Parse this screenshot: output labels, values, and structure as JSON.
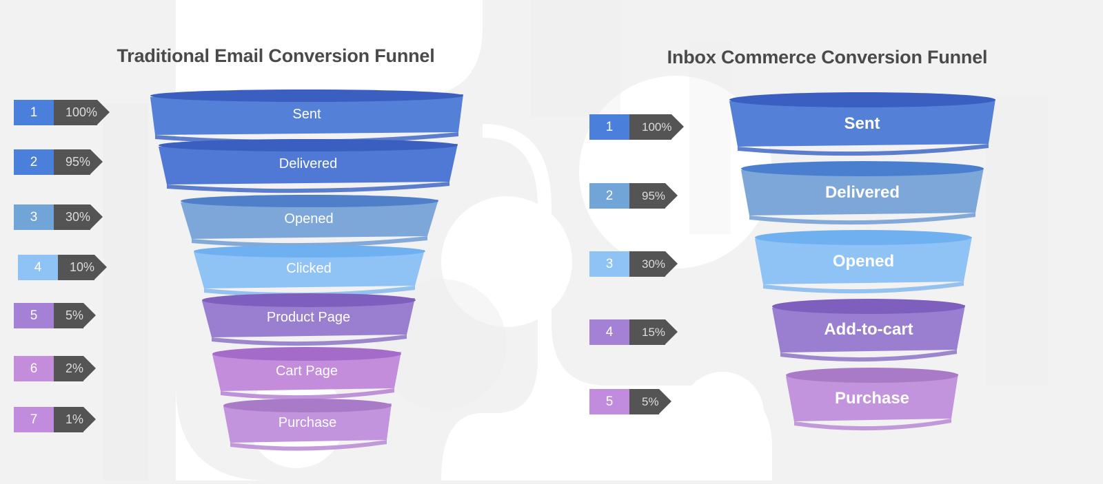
{
  "chart_data": [
    {
      "type": "funnel",
      "title": "Traditional Email Conversion Funnel",
      "side": "left",
      "categories": [
        "Sent",
        "Delivered",
        "Opened",
        "Clicked",
        "Product Page",
        "Cart Page",
        "Purchase"
      ],
      "values": [
        100,
        95,
        30,
        10,
        5,
        2,
        1
      ],
      "value_labels": [
        "100%",
        "95%",
        "30%",
        "10%",
        "5%",
        "2%",
        "1%"
      ],
      "step_numbers": [
        "1",
        "2",
        "3",
        "4",
        "5",
        "6",
        "7"
      ],
      "colors": [
        "#5580d8",
        "#4f79d4",
        "#7da7d9",
        "#8fc2f5",
        "#9a7fd0",
        "#c38ddc",
        "#c294dd"
      ],
      "top_colors": [
        "#3a5fc0",
        "#3a5fc0",
        "#4f7fc8",
        "#6fb0f0",
        "#7f5fbe",
        "#a56bc8",
        "#a87ac8"
      ],
      "ylabel": "",
      "xlabel": ""
    },
    {
      "type": "funnel",
      "title": "Inbox Commerce Conversion Funnel",
      "side": "right",
      "categories": [
        "Sent",
        "Delivered",
        "Opened",
        "Add-to-cart",
        "Purchase"
      ],
      "values": [
        100,
        95,
        30,
        15,
        5
      ],
      "value_labels": [
        "100%",
        "95%",
        "30%",
        "15%",
        "5%"
      ],
      "step_numbers": [
        "1",
        "2",
        "3",
        "4",
        "5"
      ],
      "colors": [
        "#5580d8",
        "#7da7d9",
        "#8fc2f5",
        "#9a7fd0",
        "#c294dd"
      ],
      "top_colors": [
        "#3a5fc0",
        "#4f7fc8",
        "#6fb0f0",
        "#7f5fbe",
        "#a87ac8"
      ],
      "ylabel": "",
      "xlabel": ""
    }
  ],
  "left": {
    "title": "Traditional Email Conversion Funnel",
    "steps": [
      {
        "num": "1",
        "pct": "100%",
        "label": "Sent",
        "num_color": "#4a7fdc"
      },
      {
        "num": "2",
        "pct": "95%",
        "label": "Delivered",
        "num_color": "#4a7fdc"
      },
      {
        "num": "3",
        "pct": "30%",
        "label": "Opened",
        "num_color": "#71a5d8"
      },
      {
        "num": "4",
        "pct": "10%",
        "label": "Clicked",
        "num_color": "#8fc2f5"
      },
      {
        "num": "5",
        "pct": "5%",
        "label": "Product Page",
        "num_color": "#a481d4"
      },
      {
        "num": "6",
        "pct": "2%",
        "label": "Cart Page",
        "num_color": "#c38ddc"
      },
      {
        "num": "7",
        "pct": "1%",
        "label": "Purchase",
        "num_color": "#c18cdd"
      }
    ]
  },
  "right": {
    "title": "Inbox Commerce Conversion Funnel",
    "steps": [
      {
        "num": "1",
        "pct": "100%",
        "label": "Sent",
        "num_color": "#4a7fdc"
      },
      {
        "num": "2",
        "pct": "95%",
        "label": "Delivered",
        "num_color": "#71a5d8"
      },
      {
        "num": "3",
        "pct": "30%",
        "label": "Opened",
        "num_color": "#8fc2f5"
      },
      {
        "num": "4",
        "pct": "15%",
        "label": "Add-to-cart",
        "num_color": "#a481d4"
      },
      {
        "num": "5",
        "pct": "5%",
        "label": "Purchase",
        "num_color": "#c18cdd"
      }
    ]
  },
  "theme": {
    "background": "#f2f2f2",
    "blob_color": "#ffffff",
    "title_color": "#4a4a4a",
    "badge_pct_bg": "#545454",
    "badge_pct_text": "#dcdcdc",
    "segment_label_color": "#ffffff"
  }
}
